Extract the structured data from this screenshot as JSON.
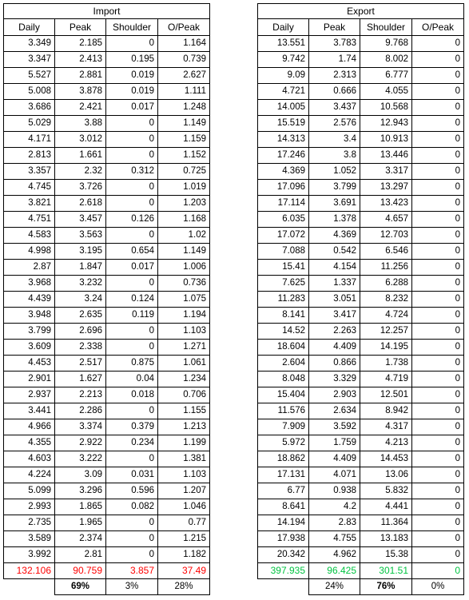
{
  "tables": [
    {
      "id": "import",
      "title": "Import",
      "total_color": "#FF0000",
      "columns": [
        "Daily",
        "Peak",
        "Shoulder",
        "O/Peak"
      ],
      "rows": [
        [
          "3.349",
          "2.185",
          "0",
          "1.164"
        ],
        [
          "3.347",
          "2.413",
          "0.195",
          "0.739"
        ],
        [
          "5.527",
          "2.881",
          "0.019",
          "2.627"
        ],
        [
          "5.008",
          "3.878",
          "0.019",
          "1.111"
        ],
        [
          "3.686",
          "2.421",
          "0.017",
          "1.248"
        ],
        [
          "5.029",
          "3.88",
          "0",
          "1.149"
        ],
        [
          "4.171",
          "3.012",
          "0",
          "1.159"
        ],
        [
          "2.813",
          "1.661",
          "0",
          "1.152"
        ],
        [
          "3.357",
          "2.32",
          "0.312",
          "0.725"
        ],
        [
          "4.745",
          "3.726",
          "0",
          "1.019"
        ],
        [
          "3.821",
          "2.618",
          "0",
          "1.203"
        ],
        [
          "4.751",
          "3.457",
          "0.126",
          "1.168"
        ],
        [
          "4.583",
          "3.563",
          "0",
          "1.02"
        ],
        [
          "4.998",
          "3.195",
          "0.654",
          "1.149"
        ],
        [
          "2.87",
          "1.847",
          "0.017",
          "1.006"
        ],
        [
          "3.968",
          "3.232",
          "0",
          "0.736"
        ],
        [
          "4.439",
          "3.24",
          "0.124",
          "1.075"
        ],
        [
          "3.948",
          "2.635",
          "0.119",
          "1.194"
        ],
        [
          "3.799",
          "2.696",
          "0",
          "1.103"
        ],
        [
          "3.609",
          "2.338",
          "0",
          "1.271"
        ],
        [
          "4.453",
          "2.517",
          "0.875",
          "1.061"
        ],
        [
          "2.901",
          "1.627",
          "0.04",
          "1.234"
        ],
        [
          "2.937",
          "2.213",
          "0.018",
          "0.706"
        ],
        [
          "3.441",
          "2.286",
          "0",
          "1.155"
        ],
        [
          "4.966",
          "3.374",
          "0.379",
          "1.213"
        ],
        [
          "4.355",
          "2.922",
          "0.234",
          "1.199"
        ],
        [
          "4.603",
          "3.222",
          "0",
          "1.381"
        ],
        [
          "4.224",
          "3.09",
          "0.031",
          "1.103"
        ],
        [
          "5.099",
          "3.296",
          "0.596",
          "1.207"
        ],
        [
          "2.993",
          "1.865",
          "0.082",
          "1.046"
        ],
        [
          "2.735",
          "1.965",
          "0",
          "0.77"
        ],
        [
          "3.589",
          "2.374",
          "0",
          "1.215"
        ],
        [
          "3.992",
          "2.81",
          "0",
          "1.182"
        ]
      ],
      "totals": [
        "132.106",
        "90.759",
        "3.857",
        "37.49"
      ],
      "percentages": [
        "",
        "69%",
        "3%",
        "28%"
      ],
      "percentage_bold": [
        false,
        true,
        false,
        false
      ]
    },
    {
      "id": "export",
      "title": "Export",
      "total_color": "#00C340",
      "columns": [
        "Daily",
        "Peak",
        "Shoulder",
        "O/Peak"
      ],
      "rows": [
        [
          "13.551",
          "3.783",
          "9.768",
          "0"
        ],
        [
          "9.742",
          "1.74",
          "8.002",
          "0"
        ],
        [
          "9.09",
          "2.313",
          "6.777",
          "0"
        ],
        [
          "4.721",
          "0.666",
          "4.055",
          "0"
        ],
        [
          "14.005",
          "3.437",
          "10.568",
          "0"
        ],
        [
          "15.519",
          "2.576",
          "12.943",
          "0"
        ],
        [
          "14.313",
          "3.4",
          "10.913",
          "0"
        ],
        [
          "17.246",
          "3.8",
          "13.446",
          "0"
        ],
        [
          "4.369",
          "1.052",
          "3.317",
          "0"
        ],
        [
          "17.096",
          "3.799",
          "13.297",
          "0"
        ],
        [
          "17.114",
          "3.691",
          "13.423",
          "0"
        ],
        [
          "6.035",
          "1.378",
          "4.657",
          "0"
        ],
        [
          "17.072",
          "4.369",
          "12.703",
          "0"
        ],
        [
          "7.088",
          "0.542",
          "6.546",
          "0"
        ],
        [
          "15.41",
          "4.154",
          "11.256",
          "0"
        ],
        [
          "7.625",
          "1.337",
          "6.288",
          "0"
        ],
        [
          "11.283",
          "3.051",
          "8.232",
          "0"
        ],
        [
          "8.141",
          "3.417",
          "4.724",
          "0"
        ],
        [
          "14.52",
          "2.263",
          "12.257",
          "0"
        ],
        [
          "18.604",
          "4.409",
          "14.195",
          "0"
        ],
        [
          "2.604",
          "0.866",
          "1.738",
          "0"
        ],
        [
          "8.048",
          "3.329",
          "4.719",
          "0"
        ],
        [
          "15.404",
          "2.903",
          "12.501",
          "0"
        ],
        [
          "11.576",
          "2.634",
          "8.942",
          "0"
        ],
        [
          "7.909",
          "3.592",
          "4.317",
          "0"
        ],
        [
          "5.972",
          "1.759",
          "4.213",
          "0"
        ],
        [
          "18.862",
          "4.409",
          "14.453",
          "0"
        ],
        [
          "17.131",
          "4.071",
          "13.06",
          "0"
        ],
        [
          "6.77",
          "0.938",
          "5.832",
          "0"
        ],
        [
          "8.641",
          "4.2",
          "4.441",
          "0"
        ],
        [
          "14.194",
          "2.83",
          "11.364",
          "0"
        ],
        [
          "17.938",
          "4.755",
          "13.183",
          "0"
        ],
        [
          "20.342",
          "4.962",
          "15.38",
          "0"
        ]
      ],
      "totals": [
        "397.935",
        "96.425",
        "301.51",
        "0"
      ],
      "percentages": [
        "",
        "24%",
        "76%",
        "0%"
      ],
      "percentage_bold": [
        false,
        false,
        true,
        false
      ]
    }
  ]
}
